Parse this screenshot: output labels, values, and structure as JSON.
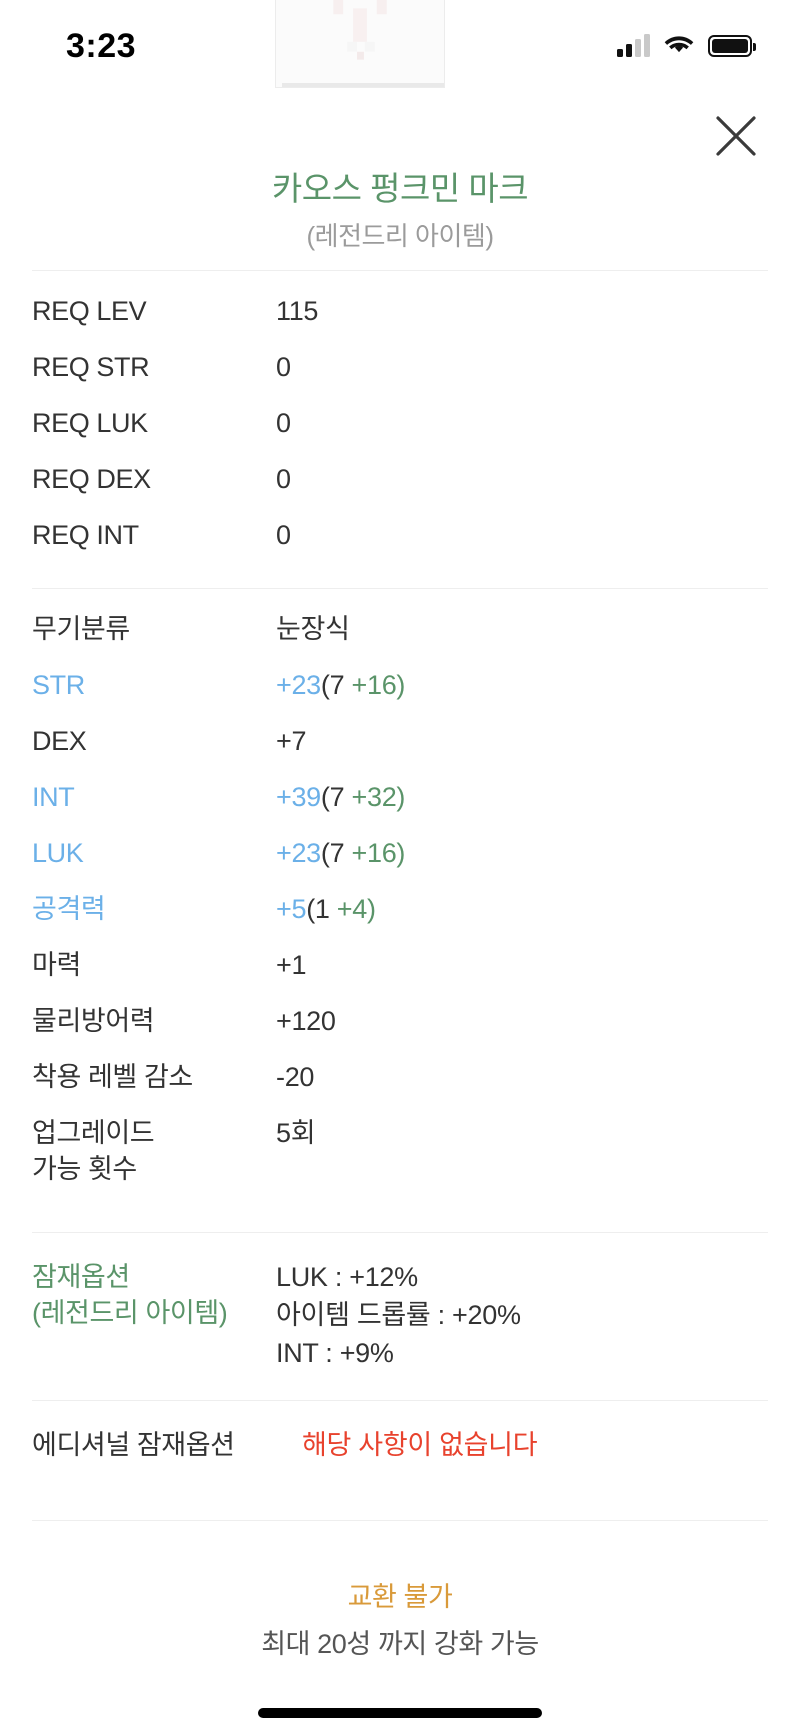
{
  "status_bar": {
    "time": "3:23",
    "signal_icon": "cellular-signal-icon",
    "signal_bars_filled": 2,
    "signal_bars_total": 4,
    "wifi_icon": "wifi-icon",
    "battery_icon": "battery-full-icon"
  },
  "header": {
    "close_icon": "close-icon",
    "thumbnail_icon": "item-thumbnail"
  },
  "item": {
    "name": "카오스 펑크민 마크",
    "grade": "(레전드리 아이템)",
    "name_color": "#5a9469",
    "grade_color": "#9b9b9b"
  },
  "requirements": [
    {
      "label": "REQ LEV",
      "value": "115"
    },
    {
      "label": "REQ STR",
      "value": "0"
    },
    {
      "label": "REQ LUK",
      "value": "0"
    },
    {
      "label": "REQ DEX",
      "value": "0"
    },
    {
      "label": "REQ INT",
      "value": "0"
    }
  ],
  "stats": [
    {
      "label": "무기분류",
      "value": "눈장식"
    },
    {
      "label": "STR",
      "total": "+23",
      "base": "(7 ",
      "bonus": "+16)"
    },
    {
      "label": "DEX",
      "value": "+7"
    },
    {
      "label": "INT",
      "total": "+39",
      "base": "(7 ",
      "bonus": "+32)"
    },
    {
      "label": "LUK",
      "total": "+23",
      "base": "(7 ",
      "bonus": "+16)"
    },
    {
      "label": "공격력",
      "total": "+5",
      "base": "(1 ",
      "bonus": "+4)"
    },
    {
      "label": "마력",
      "value": "+1"
    },
    {
      "label": "물리방어력",
      "value": "+120"
    },
    {
      "label": "착용 레벨 감소",
      "value": "-20"
    },
    {
      "label_line1": "업그레이드",
      "label_line2": "가능 횟수",
      "value": "5회"
    }
  ],
  "potential": {
    "label_line1": "잠재옵션",
    "label_line2": "(레전드리 아이템)",
    "options": [
      "LUK : +12%",
      "아이템 드롭률 : +20%",
      "INT : +9%"
    ]
  },
  "additional_potential": {
    "label": "에디셔널 잠재옵션",
    "value": "해당 사항이 없습니다",
    "value_color": "#e8422d"
  },
  "footer": {
    "trade_note": "교환 불가",
    "trade_note_color": "#d99a3a",
    "enhance_note": "최대 20성 까지 강화 가능"
  },
  "colors": {
    "accent_green": "#5a9469",
    "accent_blue": "#6bb0e8",
    "accent_red": "#e8422d",
    "accent_orange": "#d99a3a",
    "divider": "#eeeeee"
  }
}
